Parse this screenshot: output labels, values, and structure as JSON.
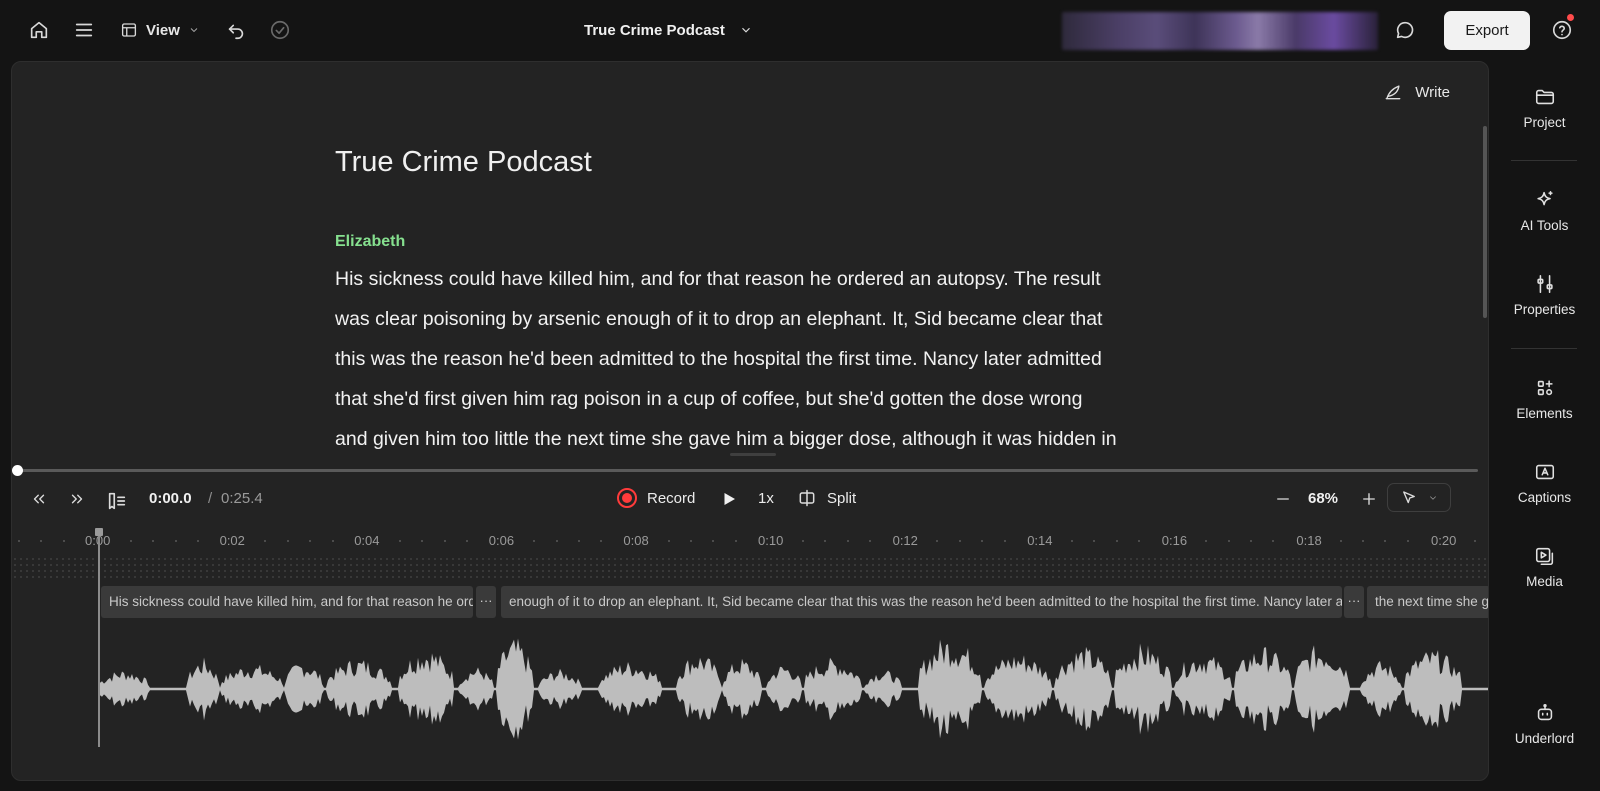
{
  "topbar": {
    "view_label": "View",
    "project_title": "True Crime Podcast",
    "export_label": "Export"
  },
  "editor": {
    "write_label": "Write",
    "doc_title": "True Crime Podcast",
    "speaker": "Elizabeth",
    "transcript_lines": [
      " His sickness could have killed him, and for that reason he ordered an autopsy. The result",
      "was clear poisoning by arsenic enough of it to drop an elephant. It, Sid became clear that",
      "this was the reason he'd been admitted to the hospital the first time. Nancy later admitted",
      "that she'd first given him rag poison in a cup of coffee, but she'd gotten the dose wrong",
      "and given him too little the next time she gave him a bigger dose, although it was hidden in"
    ]
  },
  "transport": {
    "current_time": "0:00.0",
    "separator": "/",
    "total_time": "0:25.4",
    "record_label": "Record",
    "speed": "1x",
    "split_label": "Split",
    "zoom": "68%",
    "playback_progress": 0
  },
  "timeline": {
    "ruler_labels": [
      "0:00",
      "0:02",
      "0:04",
      "0:06",
      "0:08",
      "0:10",
      "0:12",
      "0:14",
      "0:16",
      "0:18",
      "0:20"
    ],
    "clips": [
      {
        "text": "His sickness could have killed him, and for that reason he ordered an autopsy. The result was clear poisoning by arsenic"
      },
      {
        "text": "enough of it to drop an elephant. It, Sid became clear that this was the reason he'd been admitted to the hospital the first time. Nancy later admitted"
      },
      {
        "text": "the next time she gave him a bigger dose"
      }
    ],
    "more_label": "···"
  },
  "rail": {
    "items": [
      {
        "label": "Project",
        "icon": "folder-icon"
      },
      {
        "label": "AI Tools",
        "icon": "sparkle-icon"
      },
      {
        "label": "Properties",
        "icon": "sliders-icon"
      },
      {
        "label": "Elements",
        "icon": "elements-icon"
      },
      {
        "label": "Captions",
        "icon": "captions-icon"
      },
      {
        "label": "Media",
        "icon": "media-icon"
      },
      {
        "label": "Underlord",
        "icon": "robot-icon"
      }
    ]
  },
  "colors": {
    "speaker": "#86e08f",
    "record": "#ff3b3b",
    "notification": "#ff4b4b"
  }
}
